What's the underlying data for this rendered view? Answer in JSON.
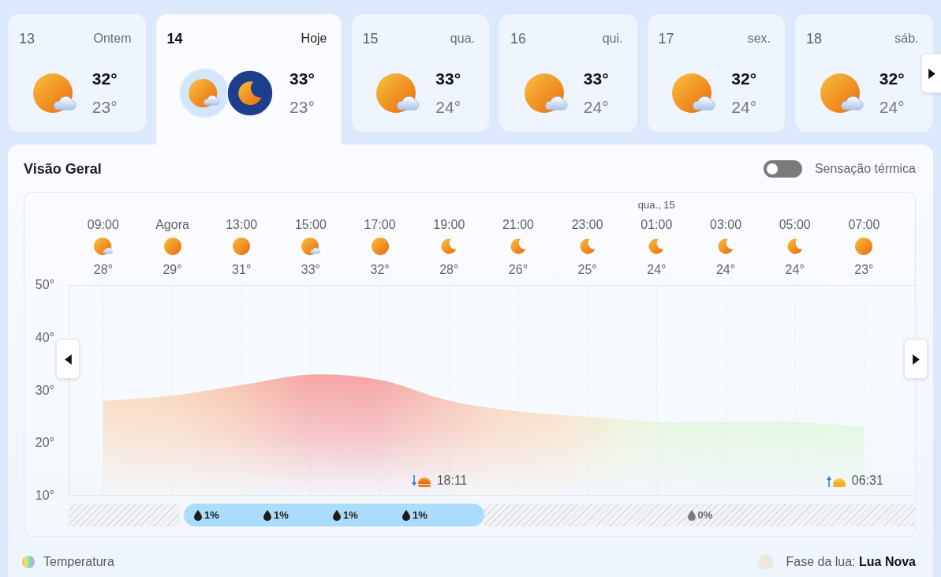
{
  "days": [
    {
      "date": "13",
      "label": "Ontem",
      "icons": [
        {
          "kind": "partly_cloudy"
        }
      ],
      "high": "32°",
      "low": "23°",
      "selected": false
    },
    {
      "date": "14",
      "label": "Hoje",
      "icons": [
        {
          "kind": "partly_cloudy"
        },
        {
          "kind": "clear_night"
        }
      ],
      "high": "33°",
      "low": "23°",
      "selected": true
    },
    {
      "date": "15",
      "label": "qua.",
      "icons": [
        {
          "kind": "partly_cloudy"
        }
      ],
      "high": "33°",
      "low": "24°",
      "selected": false
    },
    {
      "date": "16",
      "label": "qui.",
      "icons": [
        {
          "kind": "partly_cloudy"
        }
      ],
      "high": "33°",
      "low": "24°",
      "selected": false
    },
    {
      "date": "17",
      "label": "sex.",
      "icons": [
        {
          "kind": "partly_cloudy"
        }
      ],
      "high": "32°",
      "low": "24°",
      "selected": false
    },
    {
      "date": "18",
      "label": "sáb.",
      "icons": [
        {
          "kind": "partly_cloudy"
        }
      ],
      "high": "32°",
      "low": "24°",
      "selected": false
    }
  ],
  "overview": {
    "title": "Visão Geral",
    "feels_like": {
      "label": "Sensação térmica",
      "on": false
    },
    "hourly": [
      {
        "kind": "partly_cloudy",
        "temp": "28°"
      },
      {
        "kind": "sunny",
        "temp": "29°"
      },
      {
        "kind": "sunny",
        "temp": "31°"
      },
      {
        "kind": "partly_cloudy",
        "temp": "33°"
      },
      {
        "kind": "sunny",
        "temp": "32°",
        "sun_event": {
          "kind": "sunset",
          "time": "18:11"
        }
      },
      {
        "kind": "clear_night",
        "temp": "28°"
      },
      {
        "kind": "clear_night",
        "temp": "26°"
      },
      {
        "kind": "clear_night",
        "temp": "25°"
      },
      {
        "date": "qua., 15",
        "kind": "clear_night",
        "temp": "24°"
      },
      {
        "kind": "clear_night",
        "temp": "24°"
      },
      {
        "kind": "clear_night",
        "temp": "24°",
        "sun_event": {
          "kind": "sunrise",
          "time": "06:31"
        }
      },
      {
        "kind": "sunny",
        "temp": "23°"
      }
    ],
    "chart_data": {
      "type": "area",
      "categories": [
        "09:00",
        "Agora",
        "13:00",
        "15:00",
        "17:00",
        "19:00",
        "21:00",
        "23:00",
        "01:00",
        "03:00",
        "05:00",
        "07:00"
      ],
      "series": [
        {
          "name": "Temperatura",
          "values": [
            28,
            29,
            31,
            33,
            32,
            28,
            26,
            25,
            24,
            24,
            24,
            23
          ]
        }
      ],
      "ylim": [
        10,
        50
      ],
      "yticks": [
        {
          "value": 10,
          "label": "10°"
        },
        {
          "value": 20,
          "label": "20°"
        },
        {
          "value": 30,
          "label": "30°"
        },
        {
          "value": 40,
          "label": "40°"
        },
        {
          "value": 50,
          "label": "50°"
        }
      ],
      "grid": true
    },
    "precipitation": [
      {
        "kind": "past"
      },
      {
        "kind": "rain",
        "values": [
          "1%",
          "1%",
          "1%",
          "1%"
        ]
      },
      {
        "kind": "dry",
        "values": [
          "0%"
        ]
      }
    ],
    "moon_phase": "Fase da lua: **Lua Nova**"
  }
}
